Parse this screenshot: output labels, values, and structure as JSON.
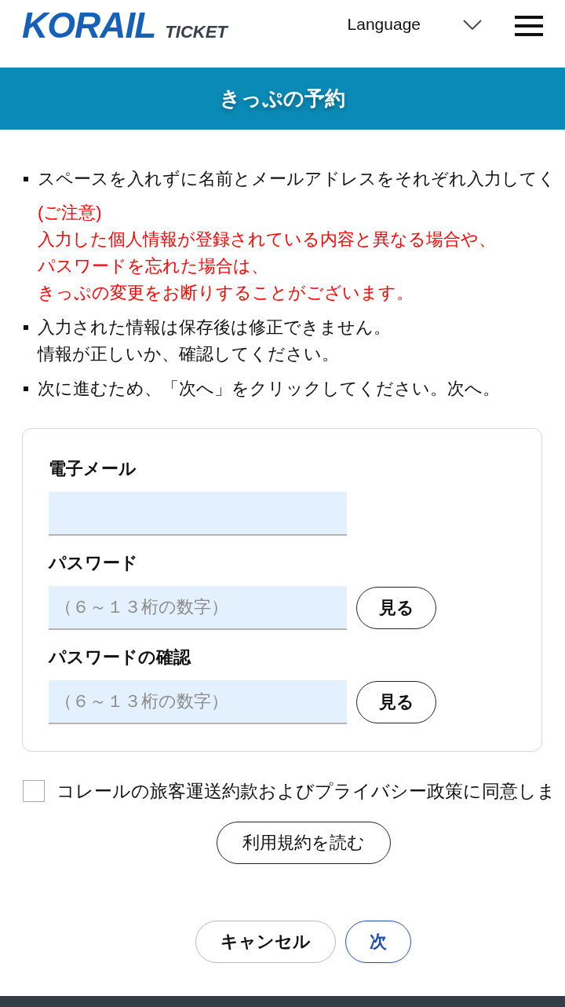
{
  "header": {
    "logo": {
      "brand": "KORAIL",
      "product": "TICKET"
    },
    "language_select": {
      "label": "Language"
    }
  },
  "page_title": "きっぷの予約",
  "notices": [
    {
      "lines": [
        "スペースを入れずに名前とメールアドレスをそれぞれ入力してく"
      ],
      "warning": {
        "title": "(ご注意)",
        "lines": [
          "入力した個人情報が登録されている内容と異なる場合や、",
          "パスワードを忘れた場合は、",
          "きっぷの変更をお断りすることがございます。"
        ]
      }
    },
    {
      "lines": [
        "入力された情報は保存後は修正できません。",
        "情報が正しいか、確認してください。"
      ]
    },
    {
      "lines": [
        "次に進むため、「次へ」をクリックしてください。次へ。"
      ]
    }
  ],
  "form": {
    "fields": [
      {
        "label": "電子メール"
      },
      {
        "label": "パスワード",
        "placeholder": "（６～１３桁の数字）",
        "button": "見る"
      },
      {
        "label": "パスワードの確認",
        "placeholder": "（６～１３桁の数字）",
        "button": "見る"
      }
    ]
  },
  "agreement": {
    "label": "コレールの旅客運送約款およびプライバシー政策に同意しま",
    "checked": false
  },
  "terms_button": "利用規約を読む",
  "actions": [
    {
      "label": "キャンセル",
      "kind": "secondary"
    },
    {
      "label": "次",
      "kind": "primary"
    }
  ]
}
